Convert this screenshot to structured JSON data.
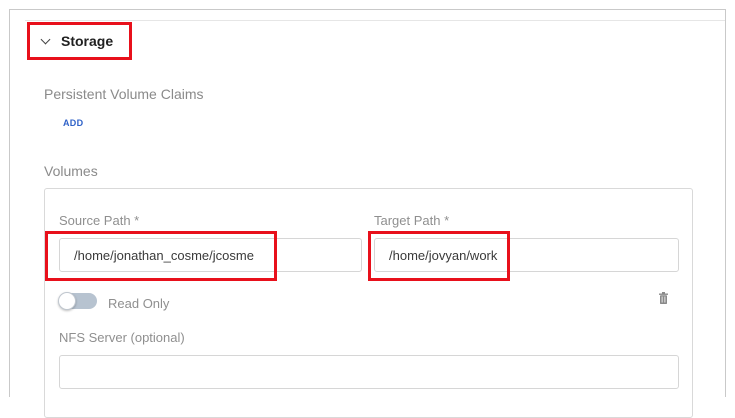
{
  "storage": {
    "title": "Storage",
    "pvc_label": "Persistent Volume Claims",
    "add_label": "ADD",
    "volumes_label": "Volumes"
  },
  "volume": {
    "source_label": "Source Path *",
    "source_value": "/home/jonathan_cosme/jcosme",
    "target_label": "Target Path *",
    "target_value": "/home/jovyan/work",
    "read_only_label": "Read Only",
    "read_only_enabled": false,
    "nfs_label": "NFS Server (optional)",
    "nfs_value": ""
  },
  "icons": {
    "chevron": "chevron-down-icon",
    "trash": "trash-icon"
  },
  "colors": {
    "highlight": "#e8101b",
    "link": "#2f62c8",
    "toggle_off": "#b7c3d0"
  }
}
